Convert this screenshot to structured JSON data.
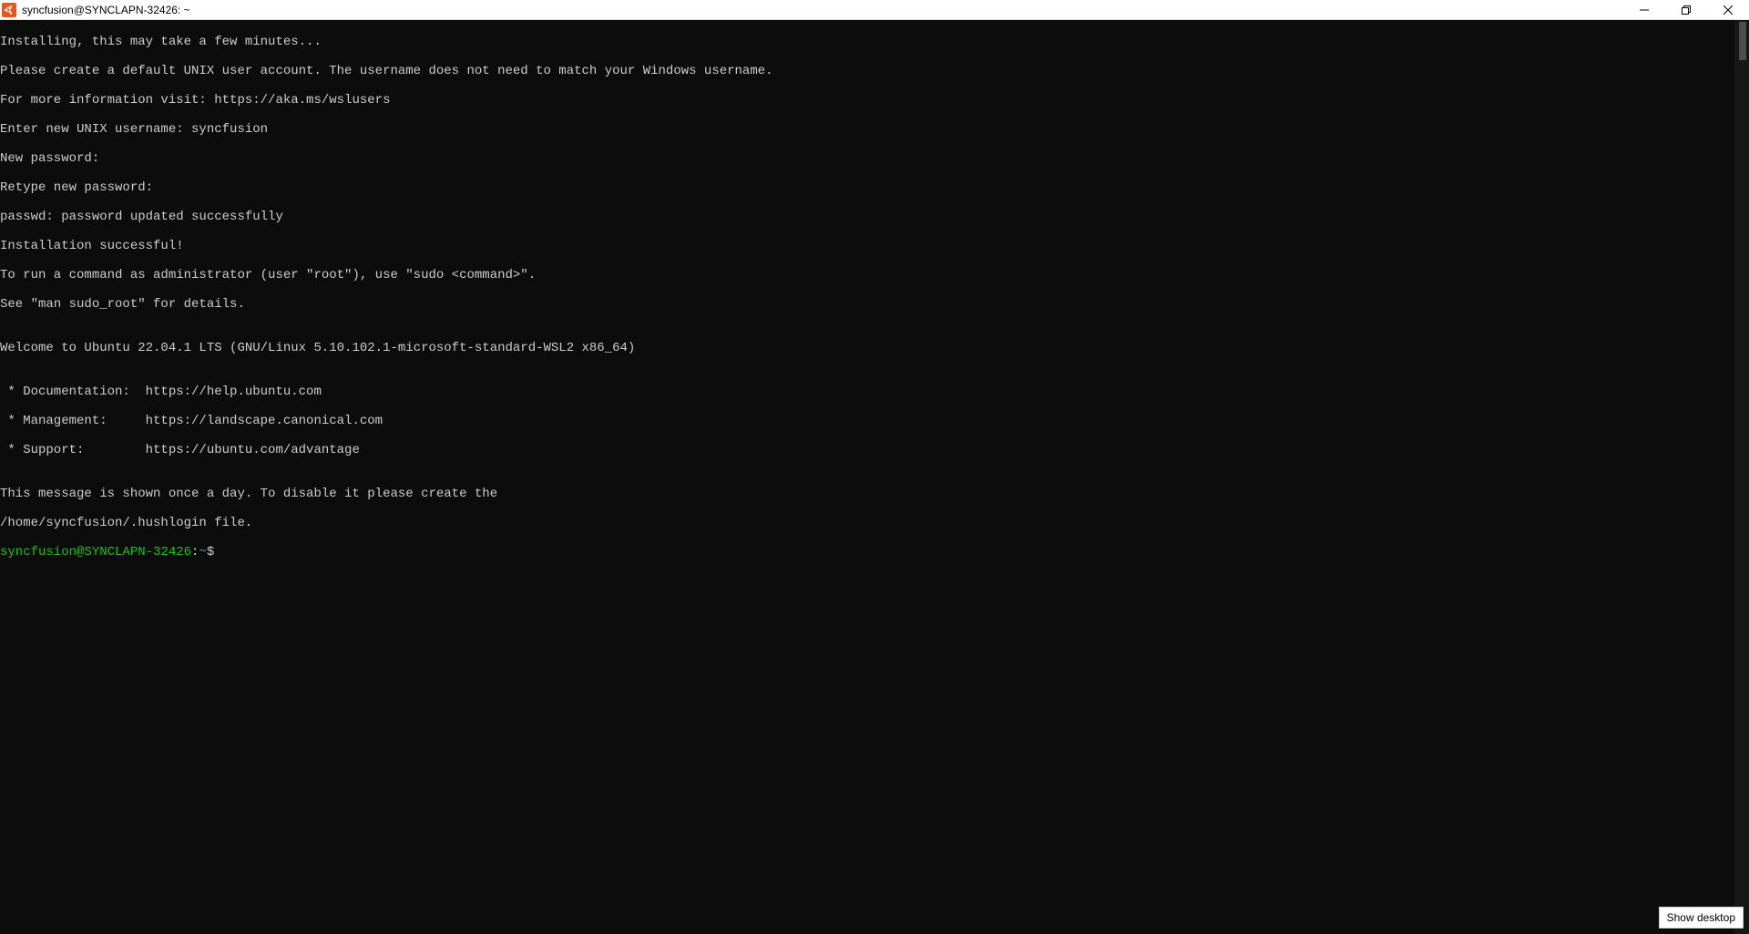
{
  "window": {
    "title": "syncfusion@SYNCLAPN-32426: ~"
  },
  "terminal": {
    "lines": [
      "Installing, this may take a few minutes...",
      "Please create a default UNIX user account. The username does not need to match your Windows username.",
      "For more information visit: https://aka.ms/wslusers",
      "Enter new UNIX username: syncfusion",
      "New password:",
      "Retype new password:",
      "passwd: password updated successfully",
      "Installation successful!",
      "To run a command as administrator (user \"root\"), use \"sudo <command>\".",
      "See \"man sudo_root\" for details.",
      "",
      "Welcome to Ubuntu 22.04.1 LTS (GNU/Linux 5.10.102.1-microsoft-standard-WSL2 x86_64)",
      "",
      " * Documentation:  https://help.ubuntu.com",
      " * Management:     https://landscape.canonical.com",
      " * Support:        https://ubuntu.com/advantage",
      "",
      "This message is shown once a day. To disable it please create the",
      "/home/syncfusion/.hushlogin file."
    ],
    "prompt": {
      "user_host": "syncfusion@SYNCLAPN-32426",
      "separator": ":",
      "path": "~",
      "symbol": "$"
    }
  },
  "tooltip": {
    "text": "Show desktop"
  }
}
